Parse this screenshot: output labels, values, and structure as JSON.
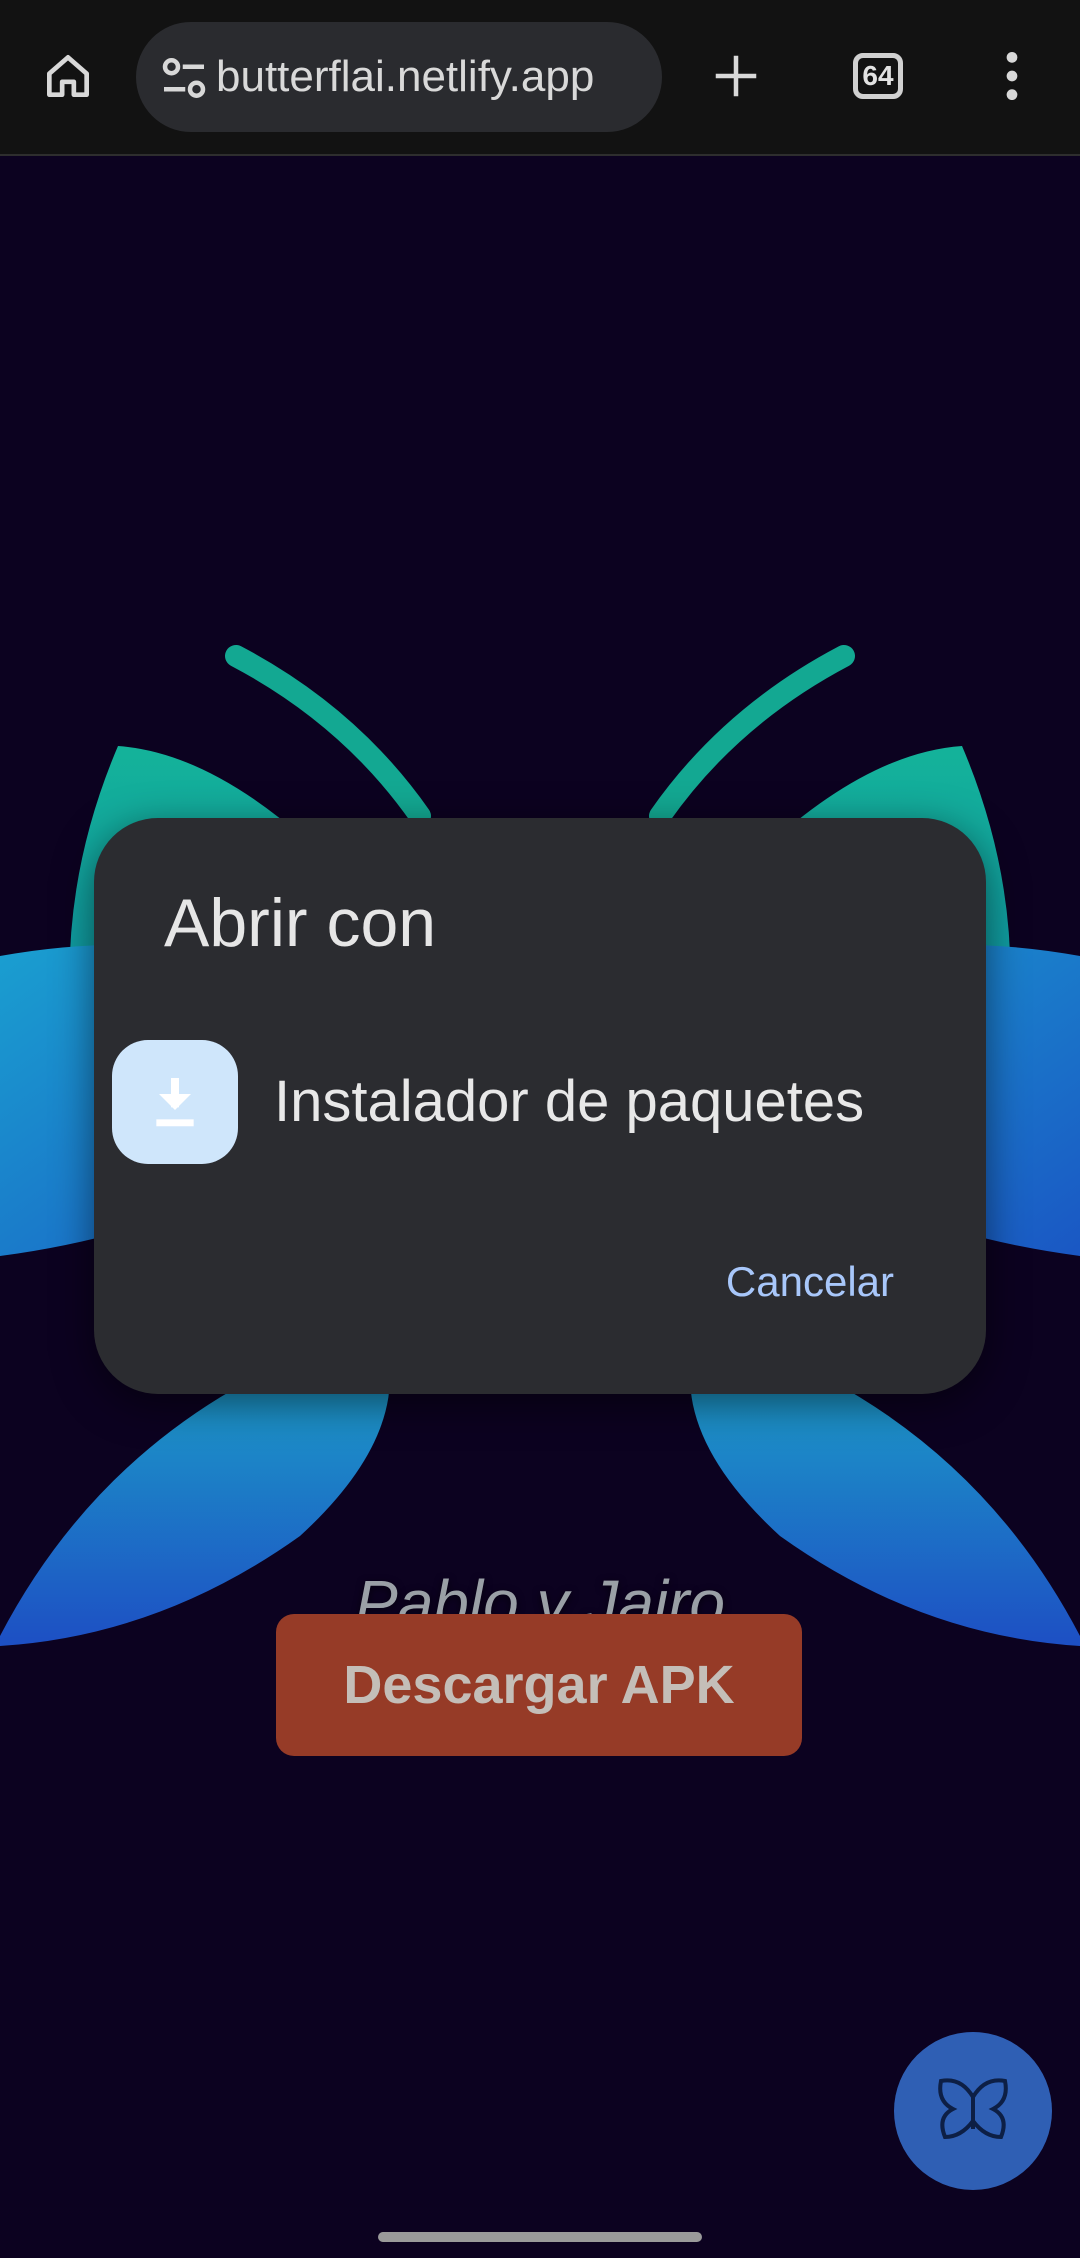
{
  "browser": {
    "url_text": "butterflai.netlify.app",
    "tab_count": "64",
    "icons": {
      "home": "home-icon",
      "site_settings": "tune-icon",
      "new_tab": "plus-icon",
      "tabs": "tab-switcher-icon",
      "menu": "more-vert-icon"
    }
  },
  "page": {
    "subtitle": "Pablo y Jairo",
    "download_button": "Descargar APK",
    "fab_icon": "butterfly-icon",
    "colors": {
      "background": "#0c0220",
      "button": "#963b27",
      "fab": "#2f5fb4"
    }
  },
  "dialog": {
    "title": "Abrir con",
    "option_label": "Instalador de paquetes",
    "option_icon": "download-icon",
    "cancel": "Cancelar"
  }
}
